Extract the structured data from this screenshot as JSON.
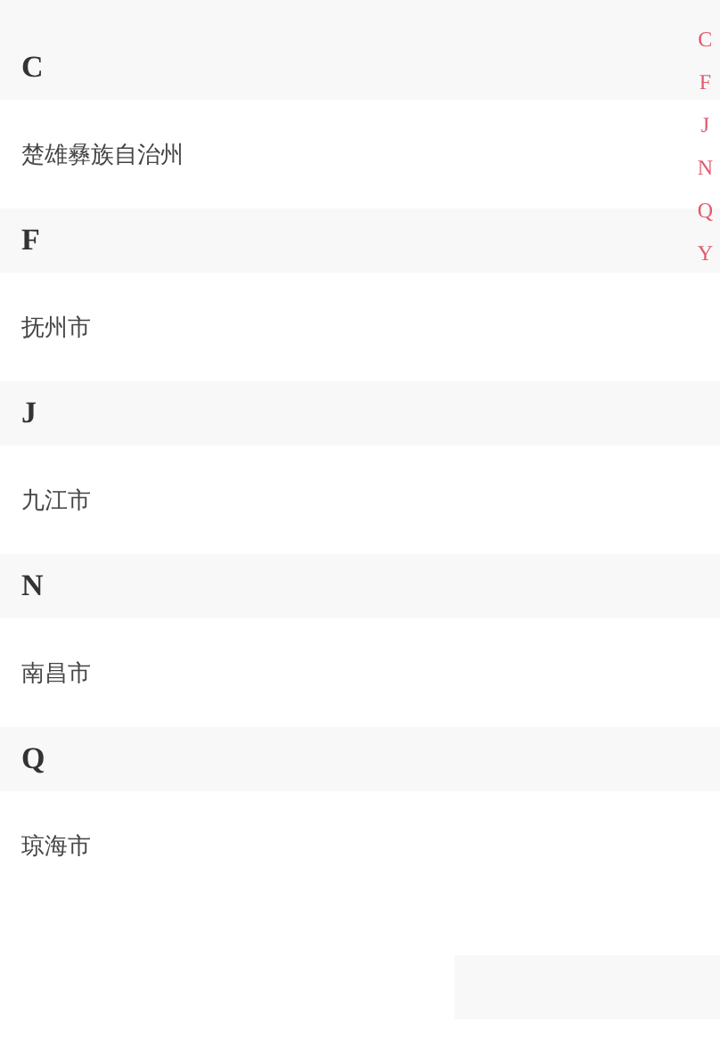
{
  "sections": [
    {
      "letter": "C",
      "cities": [
        "楚雄彝族自治州"
      ]
    },
    {
      "letter": "F",
      "cities": [
        "抚州市"
      ]
    },
    {
      "letter": "J",
      "cities": [
        "九江市"
      ]
    },
    {
      "letter": "N",
      "cities": [
        "南昌市"
      ]
    },
    {
      "letter": "Q",
      "cities": [
        "琼海市"
      ]
    }
  ],
  "index": [
    "C",
    "F",
    "J",
    "N",
    "Q",
    "Y"
  ]
}
